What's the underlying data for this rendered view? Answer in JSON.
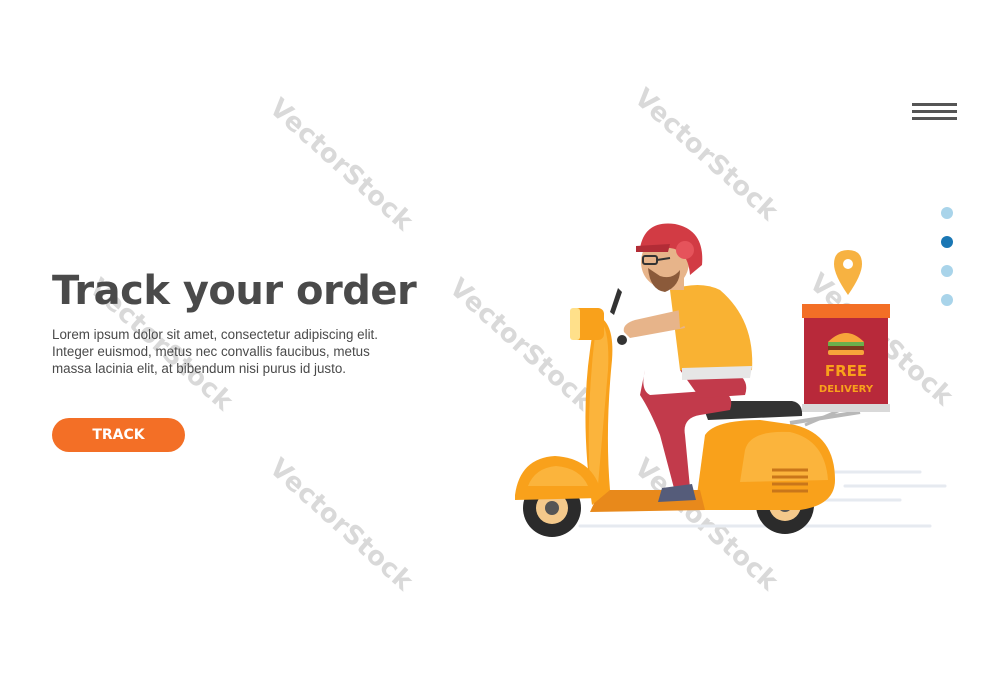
{
  "watermark": "VectorStock",
  "hero": {
    "title": "Track your order",
    "body": "Lorem ipsum dolor sit amet, consectetur adipiscing elit. Integer euismod, metus nec convallis faucibus, metus massa lacinia elit, at bibendum nisi purus id justo.",
    "button_label": "TRACK"
  },
  "delivery_box": {
    "line1": "FREE",
    "line2": "DELIVERY"
  },
  "pagination": {
    "count": 4,
    "active_index": 1
  },
  "icons": [
    "menu-icon",
    "location-pin-icon",
    "burger-icon"
  ],
  "colors": {
    "accent": "#f36f26",
    "title": "#4a4a4a",
    "dot_active": "#1a77b4",
    "dot_inactive": "#a9d4ea",
    "scooter": "#f9a11b",
    "box": "#b8293a"
  }
}
